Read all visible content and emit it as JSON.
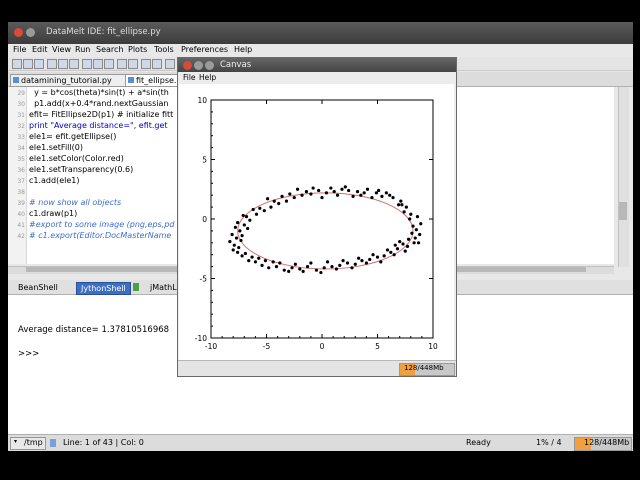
{
  "ide": {
    "title": "DataMelt IDE: fit_ellipse.py",
    "menu": [
      "File",
      "Edit",
      "View",
      "Run",
      "Search",
      "Plots",
      "Tools",
      "Preferences",
      "Help"
    ],
    "tabs": [
      {
        "label": "datamining_tutorial.py"
      },
      {
        "label": "fit_ellipse.py"
      }
    ],
    "editor": {
      "line_numbers": [
        "29",
        "30",
        "31",
        "32",
        "33",
        "34",
        "35",
        "36",
        "37",
        "38",
        "39",
        "40",
        "41",
        "42"
      ],
      "lines": [
        "  y = b*cos(theta)*sin(t) + a*sin(th",
        "  p1.add(x+0.4*rand.nextGaussian",
        "efit= FitEllipse2D(p1) # initialize fitt",
        "print \"Average distance=\", efit.get",
        "ele1= efit.getEllipse()",
        "ele1.setFill(0)",
        "ele1.setColor(Color.red)",
        "ele1.setTransparency(0.6)",
        "c1.add(ele1)",
        "",
        "# now show all objects",
        "c1.draw(p1)",
        "#export to some image (png,eps,pd",
        "# c1.export(Editor.DocMasterName"
      ]
    },
    "console_tabs": [
      "BeanShell",
      "JythonShell",
      "jMathL"
    ],
    "console_lines": [
      "Average distance= 1.37810516968",
      ">>>"
    ],
    "status": {
      "path": "/tmp",
      "position": "Line: 1 of 43 |  Col: 0",
      "state": "Ready",
      "percent": "1% / 4",
      "memory": "128/448Mb",
      "memory_fraction": 0.286
    }
  },
  "canvas_window": {
    "title": "Canvas",
    "menu": [
      "File",
      "Help"
    ],
    "memory": "128/448Mb",
    "memory_fraction": 0.286
  },
  "chart_data": {
    "type": "scatter",
    "title": "",
    "xlabel": "",
    "ylabel": "",
    "xlim": [
      -10,
      10
    ],
    "ylim": [
      -10,
      10
    ],
    "xticks": [
      -10,
      -5,
      0,
      5,
      10
    ],
    "yticks": [
      -10,
      -5,
      0,
      5,
      10
    ],
    "ellipse": {
      "cx": 0.3,
      "cy": -1.0,
      "rx": 7.9,
      "ry": 3.2,
      "color": "#c03030"
    },
    "points_color": "#000000",
    "points": [
      [
        8.2,
        -0.6
      ],
      [
        8.0,
        0.4
      ],
      [
        7.6,
        1.0
      ],
      [
        7.1,
        1.5
      ],
      [
        6.4,
        1.8
      ],
      [
        5.8,
        2.2
      ],
      [
        5.1,
        2.4
      ],
      [
        4.5,
        1.8
      ],
      [
        3.8,
        2.2
      ],
      [
        3.2,
        2.3
      ],
      [
        2.4,
        2.4
      ],
      [
        1.8,
        2.5
      ],
      [
        1.1,
        2.3
      ],
      [
        0.4,
        2.2
      ],
      [
        -0.3,
        2.4
      ],
      [
        -1.0,
        2.1
      ],
      [
        -1.8,
        2.0
      ],
      [
        -2.5,
        1.8
      ],
      [
        -3.2,
        1.5
      ],
      [
        -3.9,
        1.3
      ],
      [
        -4.6,
        1.0
      ],
      [
        -5.2,
        0.7
      ],
      [
        -5.9,
        0.4
      ],
      [
        -6.5,
        -0.1
      ],
      [
        -7.0,
        -0.5
      ],
      [
        -7.4,
        -1.0
      ],
      [
        -7.7,
        -1.6
      ],
      [
        -7.9,
        -2.2
      ],
      [
        -7.6,
        -2.8
      ],
      [
        -7.2,
        -3.1
      ],
      [
        -6.6,
        -3.5
      ],
      [
        -6.0,
        -3.6
      ],
      [
        -5.4,
        -3.9
      ],
      [
        -4.8,
        -4.1
      ],
      [
        -4.1,
        -4.0
      ],
      [
        -3.4,
        -4.3
      ],
      [
        -2.7,
        -4.1
      ],
      [
        -2.0,
        -4.2
      ],
      [
        -1.3,
        -4.0
      ],
      [
        -0.5,
        -4.3
      ],
      [
        0.2,
        -4.1
      ],
      [
        0.9,
        -4.0
      ],
      [
        1.6,
        -3.9
      ],
      [
        2.3,
        -3.7
      ],
      [
        3.0,
        -3.8
      ],
      [
        3.6,
        -3.5
      ],
      [
        4.3,
        -3.4
      ],
      [
        5.0,
        -3.2
      ],
      [
        5.6,
        -3.1
      ],
      [
        6.2,
        -2.8
      ],
      [
        6.8,
        -2.5
      ],
      [
        7.3,
        -2.1
      ],
      [
        7.8,
        -1.7
      ],
      [
        8.1,
        -1.2
      ],
      [
        8.5,
        -0.9
      ],
      [
        8.8,
        -1.3
      ],
      [
        8.3,
        -2.0
      ],
      [
        7.9,
        0.0
      ],
      [
        8.6,
        0.2
      ],
      [
        7.4,
        0.6
      ],
      [
        6.9,
        1.2
      ],
      [
        5.4,
        1.9
      ],
      [
        4.1,
        2.5
      ],
      [
        2.8,
        1.9
      ],
      [
        1.4,
        2.0
      ],
      [
        0.0,
        1.8
      ],
      [
        -1.4,
        2.3
      ],
      [
        -2.9,
        2.1
      ],
      [
        -4.3,
        1.5
      ],
      [
        -5.6,
        0.9
      ],
      [
        -6.8,
        0.2
      ],
      [
        -7.6,
        -0.3
      ],
      [
        -8.1,
        -1.3
      ],
      [
        -7.3,
        -1.8
      ],
      [
        -8.0,
        -2.6
      ],
      [
        -6.9,
        -2.9
      ],
      [
        -6.3,
        -3.2
      ],
      [
        -5.1,
        -3.5
      ],
      [
        -3.8,
        -3.7
      ],
      [
        -2.4,
        -3.8
      ],
      [
        -1.0,
        -3.7
      ],
      [
        0.5,
        -3.6
      ],
      [
        1.9,
        -3.5
      ],
      [
        3.3,
        -3.3
      ],
      [
        4.6,
        -3.0
      ],
      [
        5.9,
        -2.6
      ],
      [
        6.6,
        -2.2
      ],
      [
        7.0,
        -1.9
      ],
      [
        7.7,
        -2.3
      ],
      [
        8.4,
        -1.6
      ],
      [
        -7.1,
        0.3
      ],
      [
        -6.2,
        0.8
      ],
      [
        -4.9,
        1.7
      ],
      [
        -3.6,
        1.9
      ],
      [
        -2.2,
        2.5
      ],
      [
        -0.8,
        2.6
      ],
      [
        0.8,
        2.6
      ],
      [
        2.1,
        2.7
      ],
      [
        3.5,
        2.0
      ],
      [
        4.9,
        2.2
      ],
      [
        6.1,
        2.0
      ],
      [
        7.2,
        1.2
      ],
      [
        8.9,
        -0.4
      ],
      [
        -7.8,
        -0.7
      ],
      [
        -8.3,
        -1.9
      ],
      [
        -7.5,
        -2.4
      ],
      [
        -5.7,
        -3.3
      ],
      [
        -4.4,
        -3.6
      ],
      [
        -3.0,
        -4.4
      ],
      [
        -1.7,
        -4.4
      ],
      [
        -0.1,
        -4.5
      ],
      [
        1.3,
        -4.2
      ],
      [
        2.7,
        -4.1
      ],
      [
        4.0,
        -3.7
      ],
      [
        5.3,
        -3.6
      ],
      [
        6.5,
        -3.0
      ],
      [
        7.5,
        -2.7
      ],
      [
        8.7,
        -2.0
      ],
      [
        -6.7,
        -0.8
      ],
      [
        -7.2,
        -1.4
      ]
    ]
  }
}
